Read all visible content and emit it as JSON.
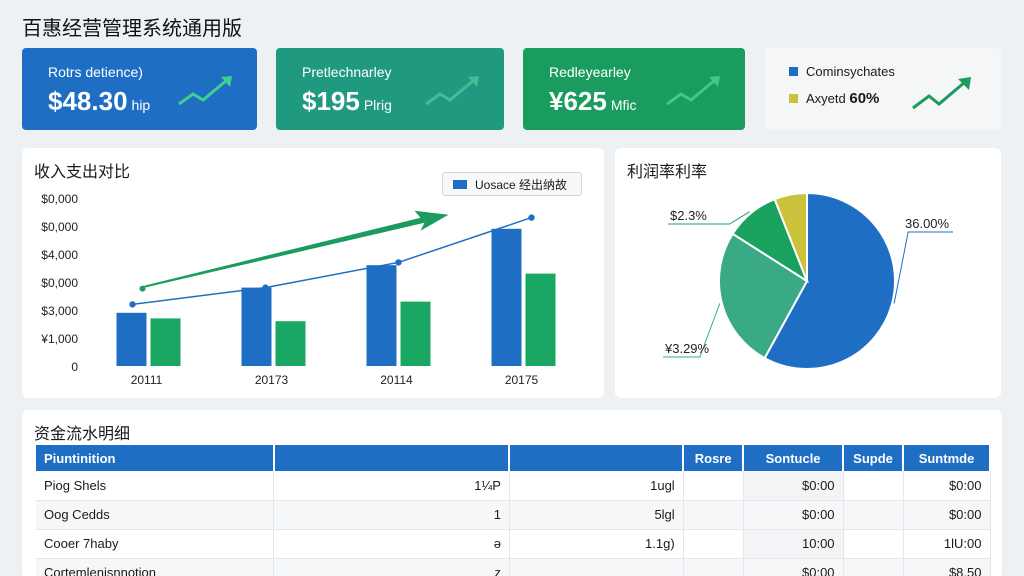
{
  "app": {
    "title": "百惠经营管理系统通用版"
  },
  "kpis": [
    {
      "label": "Rotrs detience)",
      "value": "$48.30",
      "unit": "hip"
    },
    {
      "label": "Pretlechnarley",
      "value": "$195",
      "unit": "Plrig"
    },
    {
      "label": "Redleyearley",
      "value": "¥625",
      "unit": "Mfic"
    }
  ],
  "kpi_legend": {
    "items": [
      {
        "label": "Cominsychates",
        "color": "#1e6fc4"
      },
      {
        "label": "Axyetd",
        "value": "60%",
        "color": "#c9c23a"
      }
    ]
  },
  "colors": {
    "blue": "#1e6fc4",
    "green": "#1aa764",
    "teal": "#3aaa86",
    "olive": "#c9c23a"
  },
  "bar_panel": {
    "title": "收入支出对比",
    "legend_label": "Uosace 经出纳故"
  },
  "pie_panel": {
    "title": "利润率利率"
  },
  "chart_data": [
    {
      "type": "bar",
      "title": "收入支出对比",
      "categories": [
        "20111",
        "20173",
        "20114",
        "20175"
      ],
      "y_tick_labels": [
        "0",
        "¥1,000",
        "$3,000",
        "$0,000",
        "$4,000",
        "$0,000",
        "$0,000"
      ],
      "ylim": [
        0,
        6
      ],
      "series": [
        {
          "name": "Uosace 经出纳故",
          "color": "#1e6fc4",
          "values": [
            1.9,
            2.8,
            3.6,
            4.9
          ]
        },
        {
          "color": "#1aa764",
          "values": [
            1.7,
            1.6,
            2.3,
            3.3
          ]
        }
      ],
      "line": {
        "color": "#1e6fc4",
        "values": [
          2.2,
          2.8,
          3.7,
          5.3
        ]
      },
      "trend_arrow": {
        "color": "#1a9c5f",
        "from": [
          0,
          2.8
        ],
        "to": [
          2.5,
          5.4
        ]
      },
      "grid": false,
      "legend": "top-right"
    },
    {
      "type": "pie",
      "title": "利润率利率",
      "slices": [
        {
          "label": "36.00%",
          "value": 58,
          "color": "#1e6fc4"
        },
        {
          "label": "¥3.29%",
          "value": 26,
          "color": "#3aaa86"
        },
        {
          "label": "$2.3%",
          "value": 10,
          "color": "#19a15e"
        },
        {
          "label": "",
          "value": 6,
          "color": "#c9c23a"
        }
      ]
    }
  ],
  "table": {
    "title": "资金流水明细",
    "columns": [
      "Piuntinition",
      "",
      "",
      "Rosre",
      "Sontucle",
      "Supde",
      "Suntmde"
    ],
    "rows": [
      [
        "Piog Shels",
        "1¼P",
        "1ugl",
        "",
        "$0:00",
        "",
        "$0:00"
      ],
      [
        "Oog Cedds",
        "1",
        "5lgl",
        "",
        "$0:00",
        "",
        "$0:00"
      ],
      [
        "Cooer 7haby",
        "ǝ",
        "1.1g)",
        "",
        "10:00",
        "",
        "1lU:00"
      ],
      [
        "Cortemlenisnnotion",
        "z",
        "",
        "",
        "$0:00",
        "",
        "$8.50"
      ]
    ]
  }
}
